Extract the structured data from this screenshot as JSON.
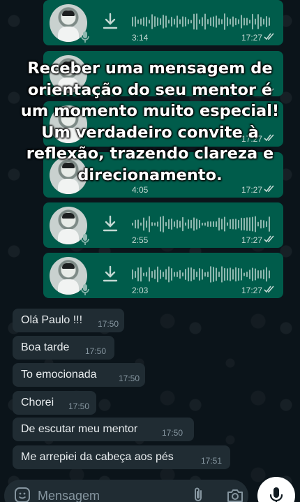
{
  "caption": {
    "lines": [
      "Receber uma mensagem de",
      "orientação do seu mentor é",
      "um momento muito especial!",
      "Um verdadeiro convite à",
      "reflexão, trazendo clareza e",
      "direcionamento."
    ]
  },
  "audio_messages": [
    {
      "duration": "3:14",
      "time": "17:27"
    },
    {
      "duration": "",
      "time": ""
    },
    {
      "duration": "",
      "time": "17:27"
    },
    {
      "duration": "4:05",
      "time": "17:27"
    },
    {
      "duration": "2:55",
      "time": "17:27"
    },
    {
      "duration": "2:03",
      "time": "17:27"
    }
  ],
  "messages": [
    {
      "text": "Olá Paulo !!!",
      "time": "17:50"
    },
    {
      "text": "Boa tarde",
      "time": "17:50"
    },
    {
      "text": "To emocionada",
      "time": "17:50"
    },
    {
      "text": "Chorei",
      "time": "17:50"
    },
    {
      "text": "De escutar meu mentor",
      "time": "17:50"
    },
    {
      "text": "Me arrepiei da cabeça aos pés",
      "time": "17:51"
    }
  ],
  "composer": {
    "placeholder": "Mensagem"
  },
  "colors": {
    "outgoing": "#005c4b",
    "incoming": "#202c33",
    "read_ticks": "#53bdeb"
  }
}
